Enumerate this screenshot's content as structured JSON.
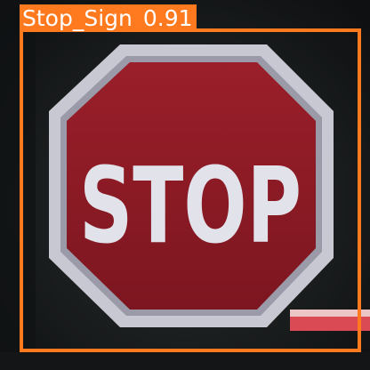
{
  "detection": {
    "class_name": "Stop_Sign",
    "confidence": "0.91",
    "box_color": "#ff7a1f"
  },
  "sign": {
    "text": "STOP",
    "face_color": "#8e1a24",
    "border_color": "#c8c8d2"
  }
}
